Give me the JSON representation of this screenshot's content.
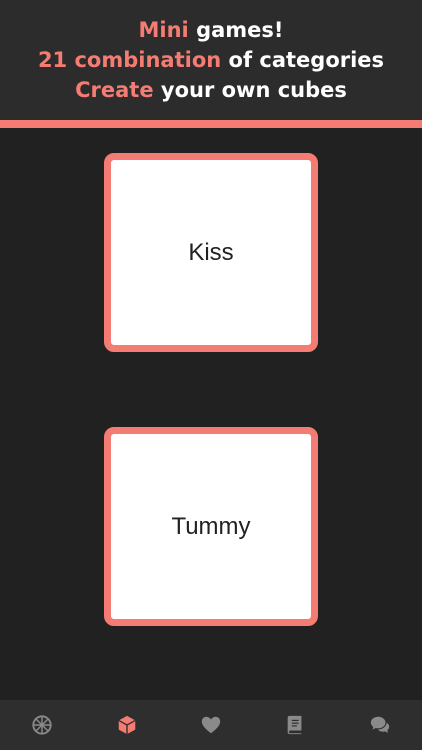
{
  "header": {
    "line1": {
      "accent": "Mini",
      "rest": " games!"
    },
    "line2": {
      "accent": "21 combination",
      "rest": " of categories"
    },
    "line3": {
      "accent": "Create",
      "rest": " your own cubes"
    }
  },
  "cubes": [
    {
      "label": "Kiss"
    },
    {
      "label": "Tummy"
    }
  ],
  "tabbar": {
    "items": [
      {
        "icon": "wheel-icon",
        "active": false
      },
      {
        "icon": "cube-icon",
        "active": true
      },
      {
        "icon": "heart-icon",
        "active": false
      },
      {
        "icon": "book-icon",
        "active": false
      },
      {
        "icon": "chat-icon",
        "active": false
      }
    ]
  },
  "colors": {
    "accent": "#f57c72",
    "background": "#222122",
    "header": "#2d2c2d",
    "tabbar": "#2f2e2f",
    "icon_inactive": "#8a8a8a"
  }
}
